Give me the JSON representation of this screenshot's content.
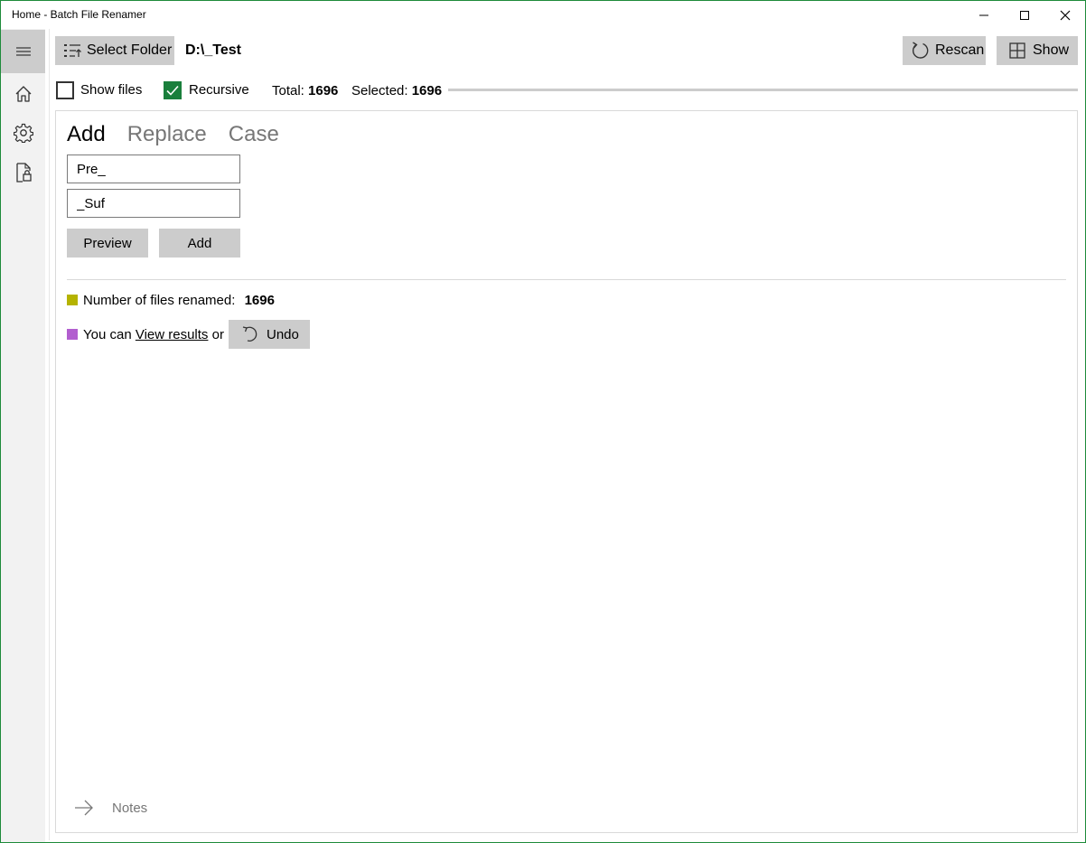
{
  "window": {
    "title": "Home - Batch File Renamer"
  },
  "toolbar": {
    "select_folder_label": "Select Folder",
    "folder_path": "D:\\_Test",
    "rescan_label": "Rescan",
    "show_label": "Show"
  },
  "options": {
    "show_files_label": "Show files",
    "show_files_checked": false,
    "recursive_label": "Recursive",
    "recursive_checked": true,
    "total_label": "Total:",
    "total_value": "1696",
    "selected_label": "Selected:",
    "selected_value": "1696"
  },
  "tabs": [
    {
      "label": "Add",
      "active": true
    },
    {
      "label": "Replace",
      "active": false
    },
    {
      "label": "Case",
      "active": false
    }
  ],
  "add_form": {
    "prefix_value": "Pre_",
    "suffix_value": "_Suf",
    "preview_label": "Preview",
    "add_label": "Add"
  },
  "results": {
    "count_label": "Number of files renamed:",
    "count_value": "1696",
    "you_can": "You can",
    "view_results": "View results",
    "or": "or",
    "undo_label": "Undo"
  },
  "notes": {
    "label": "Notes"
  },
  "colors": {
    "accent_green": "#1a7f3c",
    "count_swatch": "#b5b300",
    "undo_swatch": "#b25ecf",
    "button_gray": "#cccccc"
  },
  "icons": {
    "sidebar": [
      "hamburger-icon",
      "home-icon",
      "settings-gear-icon",
      "document-lock-icon"
    ],
    "toolbar": [
      "folder-list-icon",
      "refresh-icon",
      "grid-icon"
    ],
    "results": [
      "undo-icon"
    ],
    "notes": [
      "arrow-right-icon"
    ]
  }
}
